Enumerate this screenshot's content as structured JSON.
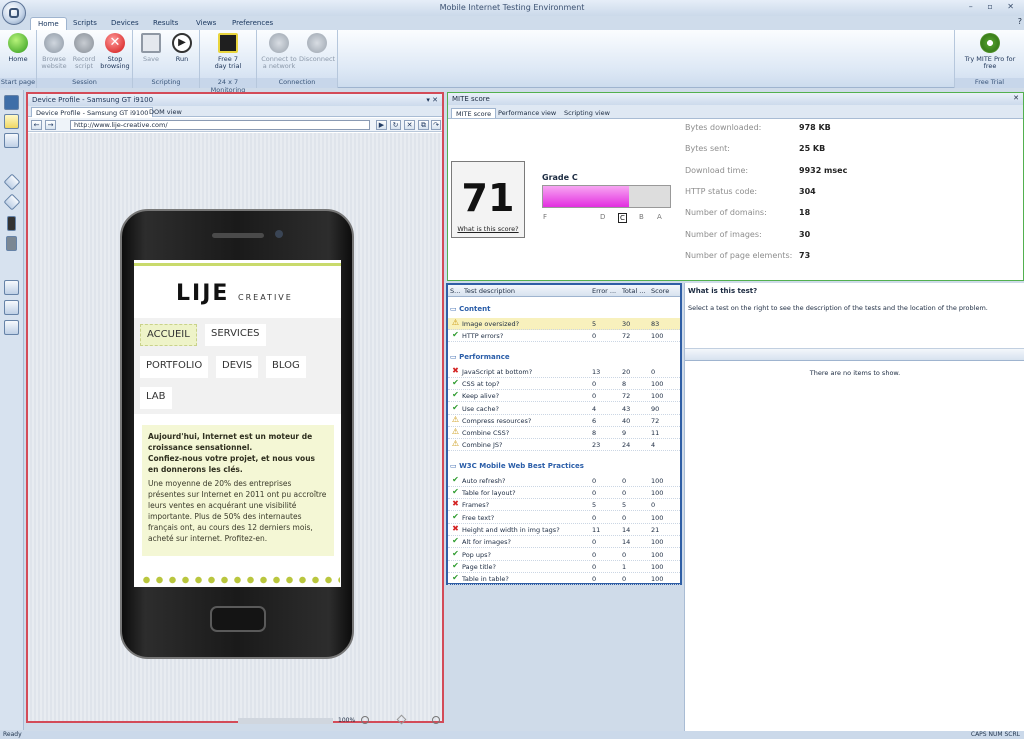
{
  "app": {
    "title": "Mobile Internet Testing Environment",
    "window_controls": "– ▫ ✕",
    "help": "?"
  },
  "tabs": [
    "Home",
    "Scripts",
    "Devices",
    "Results",
    "Views",
    "Preferences"
  ],
  "ribbon": {
    "groups": [
      {
        "label": "Start page",
        "buttons": [
          {
            "label": "Home",
            "enabled": true,
            "icon": "home-icon"
          }
        ]
      },
      {
        "label": "Session",
        "buttons": [
          {
            "label": "Browse website",
            "enabled": false,
            "icon": "globe-icon"
          },
          {
            "label": "Record script",
            "enabled": false,
            "icon": "record-icon"
          },
          {
            "label": "Stop browsing",
            "enabled": true,
            "icon": "stop-icon"
          }
        ]
      },
      {
        "label": "Scripting",
        "buttons": [
          {
            "label": "Save",
            "enabled": false,
            "icon": "save-icon"
          },
          {
            "label": "Run",
            "enabled": true,
            "icon": "play-icon"
          }
        ]
      },
      {
        "label": "24 x 7 Monitoring",
        "buttons": [
          {
            "label": "Free 7 day trial",
            "enabled": true,
            "icon": "trial-icon"
          }
        ]
      },
      {
        "label": "Connection",
        "buttons": [
          {
            "label": "Connect to a network",
            "enabled": false,
            "icon": "connect-icon"
          },
          {
            "label": "Disconnect",
            "enabled": false,
            "icon": "disconnect-icon"
          }
        ]
      },
      {
        "label": "Free Trial",
        "buttons": [
          {
            "label": "Try MITE Pro for free",
            "enabled": true,
            "icon": "gear-icon"
          }
        ]
      }
    ]
  },
  "device_panel": {
    "title": "Device Profile - Samsung GT i9100",
    "pin": "▾ ✕",
    "tabs": [
      "Device Profile - Samsung GT i9100",
      "DOM view"
    ],
    "url": "http://www.lije-creative.com/",
    "zoom": "100%"
  },
  "website": {
    "logo": "LIJE",
    "logo_sub": "CREATIVE",
    "menu": [
      "ACCUEIL",
      "SERVICES",
      "PORTFOLIO",
      "DEVIS",
      "BLOG",
      "LAB"
    ],
    "intro_bold": "Aujourd'hui, Internet est un moteur de croissance sensationnel.",
    "intro_bold2": "Confiez-nous votre projet, et nous vous en donnerons les clés.",
    "intro_text": "Une moyenne de 20% des entreprises présentes sur Internet en 2011 ont pu accroître leurs ventes en acquérant une visibilité importante. Plus de 50% des internautes français ont, au cours des 12 derniers mois, acheté sur internet. Profitez-en."
  },
  "mite_panel": {
    "title": "MITE score",
    "tabs": [
      "MITE score",
      "Performance view",
      "Scripting view"
    ],
    "score": "71",
    "score_link": "What is this score?",
    "grade": "Grade C",
    "grade_fill": 0.68,
    "grade_letters": [
      "F",
      "D",
      "C",
      "B",
      "A"
    ],
    "stats": [
      {
        "label": "Bytes downloaded:",
        "value": "978 KB"
      },
      {
        "label": "Bytes sent:",
        "value": "25 KB"
      },
      {
        "label": "Download time:",
        "value": "9932 msec"
      },
      {
        "label": "HTTP status code:",
        "value": "304"
      },
      {
        "label": "Number of domains:",
        "value": "18"
      },
      {
        "label": "Number of images:",
        "value": "30"
      },
      {
        "label": "Number of page elements:",
        "value": "73"
      }
    ]
  },
  "tests": {
    "columns": [
      "S...",
      "Test description",
      "Error ...",
      "Total ...",
      "Score"
    ],
    "sections": [
      {
        "name": "Content",
        "rows": [
          {
            "status": "warn",
            "desc": "Image oversized?",
            "err": "5",
            "total": "30",
            "score": "83"
          },
          {
            "status": "pass",
            "desc": "HTTP errors?",
            "err": "0",
            "total": "72",
            "score": "100"
          }
        ]
      },
      {
        "name": "Performance",
        "rows": [
          {
            "status": "fail",
            "desc": "JavaScript at bottom?",
            "err": "13",
            "total": "20",
            "score": "0"
          },
          {
            "status": "pass",
            "desc": "CSS at top?",
            "err": "0",
            "total": "8",
            "score": "100"
          },
          {
            "status": "pass",
            "desc": "Keep alive?",
            "err": "0",
            "total": "72",
            "score": "100"
          },
          {
            "status": "pass",
            "desc": "Use cache?",
            "err": "4",
            "total": "43",
            "score": "90"
          },
          {
            "status": "warn",
            "desc": "Compress resources?",
            "err": "6",
            "total": "40",
            "score": "72"
          },
          {
            "status": "warn",
            "desc": "Combine CSS?",
            "err": "8",
            "total": "9",
            "score": "11"
          },
          {
            "status": "warn",
            "desc": "Combine JS?",
            "err": "23",
            "total": "24",
            "score": "4"
          }
        ]
      },
      {
        "name": "W3C Mobile Web Best Practices",
        "rows": [
          {
            "status": "pass",
            "desc": "Auto refresh?",
            "err": "0",
            "total": "0",
            "score": "100"
          },
          {
            "status": "pass",
            "desc": "Table for layout?",
            "err": "0",
            "total": "0",
            "score": "100"
          },
          {
            "status": "fail",
            "desc": "Frames?",
            "err": "5",
            "total": "5",
            "score": "0"
          },
          {
            "status": "pass",
            "desc": "Free text?",
            "err": "0",
            "total": "0",
            "score": "100"
          },
          {
            "status": "fail",
            "desc": "Height and width in img tags?",
            "err": "11",
            "total": "14",
            "score": "21"
          },
          {
            "status": "pass",
            "desc": "Alt for images?",
            "err": "0",
            "total": "14",
            "score": "100"
          },
          {
            "status": "pass",
            "desc": "Pop ups?",
            "err": "0",
            "total": "0",
            "score": "100"
          },
          {
            "status": "pass",
            "desc": "Page title?",
            "err": "0",
            "total": "1",
            "score": "100"
          },
          {
            "status": "pass",
            "desc": "Table in table?",
            "err": "0",
            "total": "0",
            "score": "100"
          }
        ]
      }
    ]
  },
  "whatis": {
    "title": "What is this test?",
    "text": "Select a test on the right to see the description of the tests and the location of the problem.",
    "empty": "There are no items to show."
  },
  "status": {
    "left": "Ready",
    "right": "CAPS  NUM  SCRL"
  }
}
